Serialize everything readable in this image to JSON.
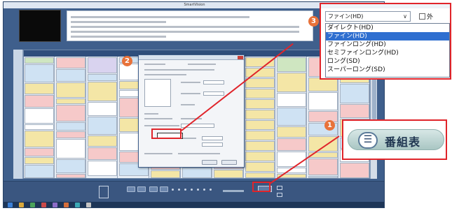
{
  "screenshot": {
    "window_title": "SmartVision"
  },
  "callouts": {
    "badge1": "1",
    "badge2": "2",
    "badge3": "3"
  },
  "program_guide_button": {
    "label": "番組表",
    "icon": "list-icon",
    "icon_glyph": "☰"
  },
  "quality_dropdown": {
    "selected": "ファイン(HD)",
    "chevron": "∨",
    "checkbox_label": "外",
    "options": [
      "ダイレクト(HD)",
      "ファイン(HD)",
      "ファインロング(HD)",
      "セミファインロング(HD)",
      "ロング(SD)",
      "スーパーロング(SD)"
    ],
    "highlighted_index": 1
  },
  "colors": {
    "accent_red": "#e0242a",
    "badge_orange": "#e8723a",
    "selection_blue": "#2f6fd0"
  }
}
